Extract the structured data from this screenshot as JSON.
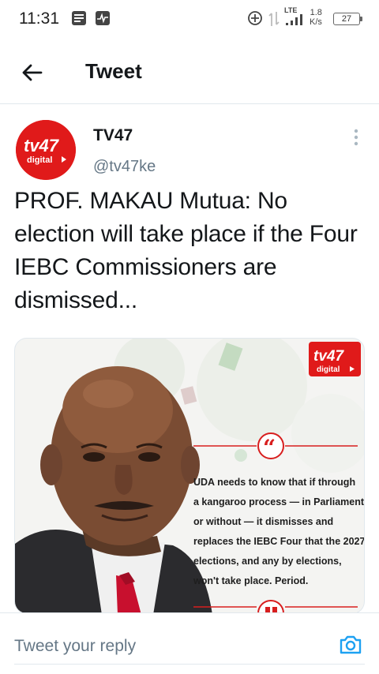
{
  "status_bar": {
    "time": "11:31",
    "network_type": "LTE",
    "speed_value": "1.8",
    "speed_unit": "K/s",
    "battery": "27",
    "icons": [
      "notes-icon",
      "activity-icon",
      "data-saver-icon",
      "data-transfer-icon",
      "signal-icon",
      "battery-icon"
    ]
  },
  "header": {
    "title": "Tweet"
  },
  "tweet": {
    "author_name": "TV47",
    "author_handle": "@tv47ke",
    "text": "PROF. MAKAU Mutua: No election will take place if the Four IEBC Commissioners are dismissed...",
    "avatar_logo_text": "tv47 digital",
    "media": {
      "logo_text": "tv47 digital",
      "quote_lines": [
        "UDA needs to know that if through",
        "a kangaroo process — in Parliament",
        "or without — it dismisses and",
        "replaces the IEBC Four that the 2027",
        "elections, and any by elections,",
        "won't take place. Period."
      ]
    }
  },
  "reply": {
    "placeholder": "Tweet your reply"
  },
  "colors": {
    "accent": "#1da1f2",
    "brand_red": "#e01a1a",
    "secondary_text": "#657786",
    "divider": "#e1e8ed"
  }
}
